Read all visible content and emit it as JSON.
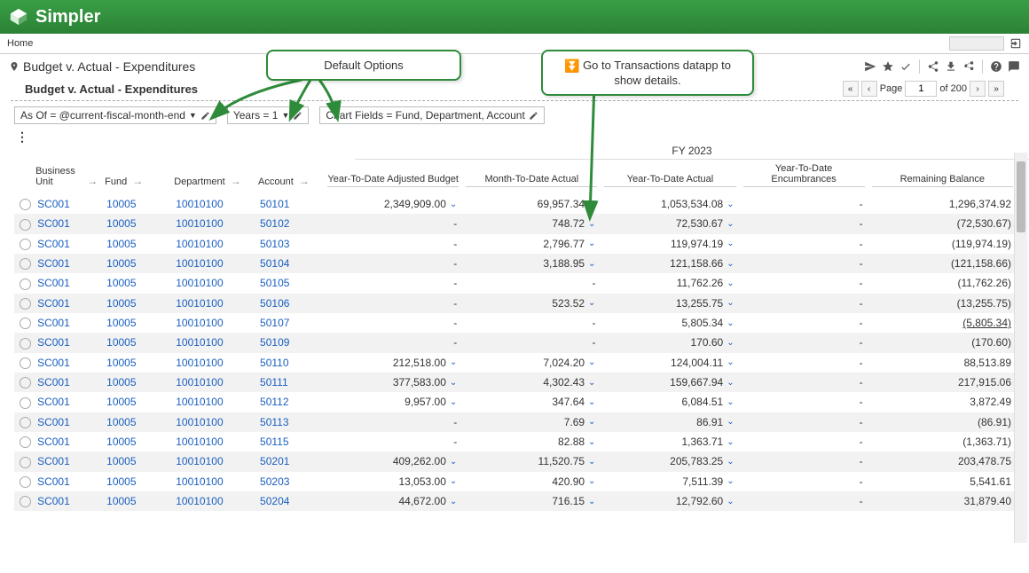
{
  "app_title": "Simpler",
  "breadcrumb": "Home",
  "page_title": "Budget v. Actual - Expenditures",
  "sub_title": "Budget v. Actual - Expenditures",
  "pager": {
    "label": "Page",
    "page": "1",
    "of": "of 200"
  },
  "filters": {
    "asof": "As Of = @current-fiscal-month-end",
    "years": "Years = 1",
    "chartfields": "Chart Fields = Fund, Department, Account"
  },
  "fy_label": "FY 2023",
  "columns": {
    "bu": "Business Unit",
    "fund": "Fund",
    "dept": "Department",
    "acct": "Account",
    "ytd_budget": "Year-To-Date Adjusted Budget",
    "mtd_actual": "Month-To-Date Actual",
    "ytd_actual": "Year-To-Date Actual",
    "ytd_enc": "Year-To-Date Encumbrances",
    "remain": "Remaining Balance"
  },
  "callouts": {
    "default_options": "Default Options",
    "transactions": "Go to Transactions datapp to show details."
  },
  "rows": [
    {
      "bu": "SC001",
      "fund": "10005",
      "dept": "10010100",
      "acct": "50101",
      "ytdb": "2,349,909.00",
      "mtd": "69,957.34",
      "ytda": "1,053,534.08",
      "enc": "-",
      "rem": "1,296,374.92"
    },
    {
      "bu": "SC001",
      "fund": "10005",
      "dept": "10010100",
      "acct": "50102",
      "ytdb": "-",
      "mtd": "748.72",
      "ytda": "72,530.67",
      "enc": "-",
      "rem": "(72,530.67)"
    },
    {
      "bu": "SC001",
      "fund": "10005",
      "dept": "10010100",
      "acct": "50103",
      "ytdb": "-",
      "mtd": "2,796.77",
      "ytda": "119,974.19",
      "enc": "-",
      "rem": "(119,974.19)"
    },
    {
      "bu": "SC001",
      "fund": "10005",
      "dept": "10010100",
      "acct": "50104",
      "ytdb": "-",
      "mtd": "3,188.95",
      "ytda": "121,158.66",
      "enc": "-",
      "rem": "(121,158.66)"
    },
    {
      "bu": "SC001",
      "fund": "10005",
      "dept": "10010100",
      "acct": "50105",
      "ytdb": "-",
      "mtd": "-",
      "ytda": "11,762.26",
      "enc": "-",
      "rem": "(11,762.26)"
    },
    {
      "bu": "SC001",
      "fund": "10005",
      "dept": "10010100",
      "acct": "50106",
      "ytdb": "-",
      "mtd": "523.52",
      "ytda": "13,255.75",
      "enc": "-",
      "rem": "(13,255.75)"
    },
    {
      "bu": "SC001",
      "fund": "10005",
      "dept": "10010100",
      "acct": "50107",
      "ytdb": "-",
      "mtd": "-",
      "ytda": "5,805.34",
      "enc": "-",
      "rem": "(5,805.34)",
      "underline": true
    },
    {
      "bu": "SC001",
      "fund": "10005",
      "dept": "10010100",
      "acct": "50109",
      "ytdb": "-",
      "mtd": "-",
      "ytda": "170.60",
      "enc": "-",
      "rem": "(170.60)"
    },
    {
      "bu": "SC001",
      "fund": "10005",
      "dept": "10010100",
      "acct": "50110",
      "ytdb": "212,518.00",
      "mtd": "7,024.20",
      "ytda": "124,004.11",
      "enc": "-",
      "rem": "88,513.89"
    },
    {
      "bu": "SC001",
      "fund": "10005",
      "dept": "10010100",
      "acct": "50111",
      "ytdb": "377,583.00",
      "mtd": "4,302.43",
      "ytda": "159,667.94",
      "enc": "-",
      "rem": "217,915.06"
    },
    {
      "bu": "SC001",
      "fund": "10005",
      "dept": "10010100",
      "acct": "50112",
      "ytdb": "9,957.00",
      "mtd": "347.64",
      "ytda": "6,084.51",
      "enc": "-",
      "rem": "3,872.49"
    },
    {
      "bu": "SC001",
      "fund": "10005",
      "dept": "10010100",
      "acct": "50113",
      "ytdb": "-",
      "mtd": "7.69",
      "ytda": "86.91",
      "enc": "-",
      "rem": "(86.91)"
    },
    {
      "bu": "SC001",
      "fund": "10005",
      "dept": "10010100",
      "acct": "50115",
      "ytdb": "-",
      "mtd": "82.88",
      "ytda": "1,363.71",
      "enc": "-",
      "rem": "(1,363.71)"
    },
    {
      "bu": "SC001",
      "fund": "10005",
      "dept": "10010100",
      "acct": "50201",
      "ytdb": "409,262.00",
      "mtd": "11,520.75",
      "ytda": "205,783.25",
      "enc": "-",
      "rem": "203,478.75"
    },
    {
      "bu": "SC001",
      "fund": "10005",
      "dept": "10010100",
      "acct": "50203",
      "ytdb": "13,053.00",
      "mtd": "420.90",
      "ytda": "7,511.39",
      "enc": "-",
      "rem": "5,541.61"
    },
    {
      "bu": "SC001",
      "fund": "10005",
      "dept": "10010100",
      "acct": "50204",
      "ytdb": "44,672.00",
      "mtd": "716.15",
      "ytda": "12,792.60",
      "enc": "-",
      "rem": "31,879.40"
    }
  ]
}
